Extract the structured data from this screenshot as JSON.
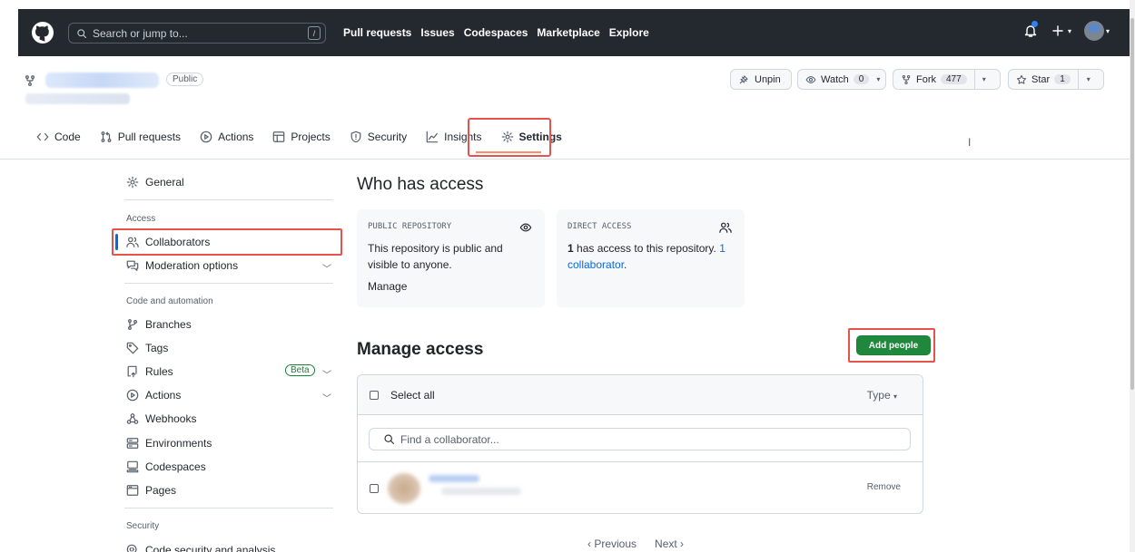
{
  "topbar": {
    "search_placeholder": "Search or jump to...",
    "search_shortcut": "/",
    "nav": [
      "Pull requests",
      "Issues",
      "Codespaces",
      "Marketplace",
      "Explore"
    ]
  },
  "repo": {
    "visibility": "Public",
    "unpin": "Unpin",
    "watch": "Watch",
    "watch_count": "0",
    "fork": "Fork",
    "fork_count": "477",
    "star": "Star",
    "star_count": "1"
  },
  "repo_nav": {
    "code": "Code",
    "pull_requests": "Pull requests",
    "actions": "Actions",
    "projects": "Projects",
    "security": "Security",
    "insights": "Insights",
    "settings": "Settings"
  },
  "sidebar": {
    "general": "General",
    "access_heading": "Access",
    "collaborators": "Collaborators",
    "moderation": "Moderation options",
    "code_heading": "Code and automation",
    "branches": "Branches",
    "tags": "Tags",
    "rules": "Rules",
    "beta": "Beta",
    "actions": "Actions",
    "webhooks": "Webhooks",
    "environments": "Environments",
    "codespaces": "Codespaces",
    "pages": "Pages",
    "security_heading": "Security",
    "code_security": "Code security and analysis"
  },
  "main": {
    "who_title": "Who has access",
    "public_card": {
      "label": "PUBLIC REPOSITORY",
      "text": "This repository is public and visible to anyone.",
      "link": "Manage"
    },
    "direct_card": {
      "label": "DIRECT ACCESS",
      "count_bold": "1",
      "text": " has access to this repository. ",
      "link": "1 collaborator",
      "tail": "."
    },
    "manage_title": "Manage access",
    "add_people": "Add people",
    "select_all": "Select all",
    "type_filter": "Type",
    "find_placeholder": "Find a collaborator...",
    "remove": "Remove",
    "previous": "Previous",
    "next": "Next"
  },
  "colors": {
    "header_bg": "#24292f",
    "accent_green": "#1f883d",
    "link_blue": "#0969da",
    "highlight_red": "#e5534b"
  }
}
